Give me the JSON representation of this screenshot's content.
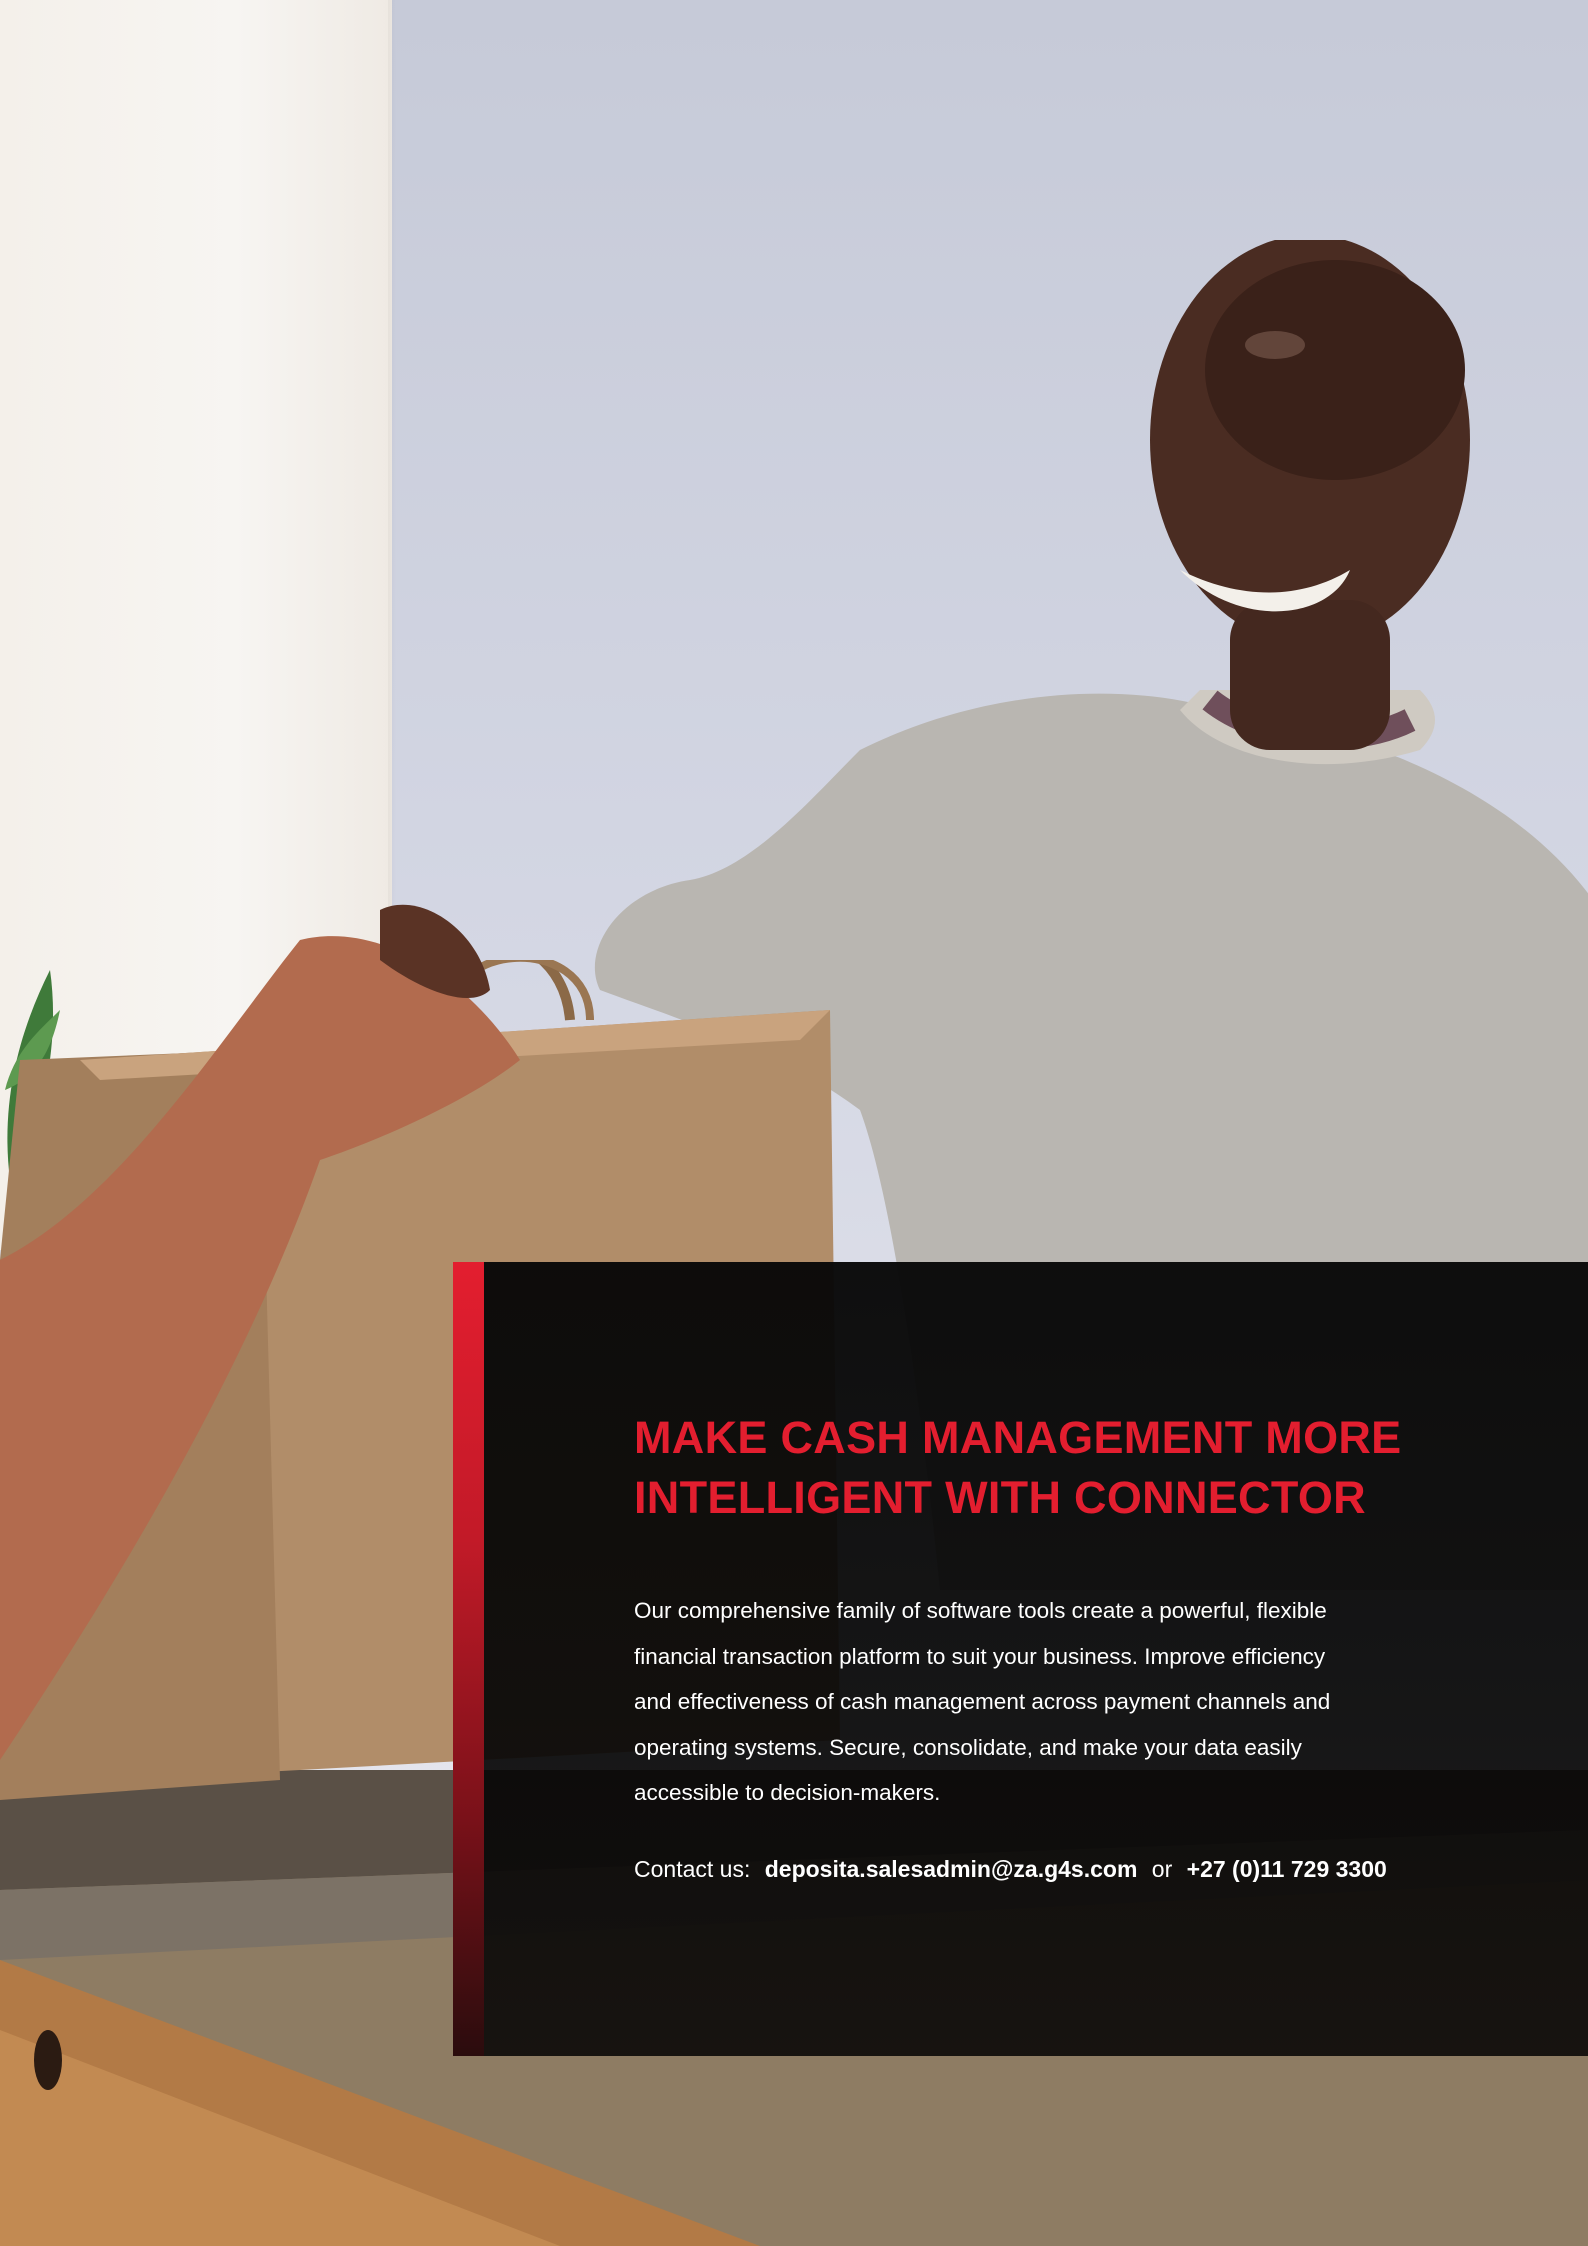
{
  "hero": {
    "headline_line1": "MAKE CASH MANAGEMENT MORE",
    "headline_line2": "INTELLIGENT WITH CONNECTOR",
    "body_lines": [
      "Our comprehensive family of software tools create a powerful, flexible",
      "financial transaction platform to suit your business. Improve efficiency",
      "and effectiveness of cash management across payment channels and",
      "operating systems. Secure, consolidate, and make your data easily",
      "accessible to decision-makers."
    ]
  },
  "contact": {
    "prefix": "Contact us:",
    "email": "deposita.salesadmin@za.g4s.com",
    "separator": "or",
    "phone": "+27 (0)11 729 3300"
  },
  "colors": {
    "accent": "#e31e2f",
    "panel": "#080808",
    "text": "#ffffff"
  }
}
